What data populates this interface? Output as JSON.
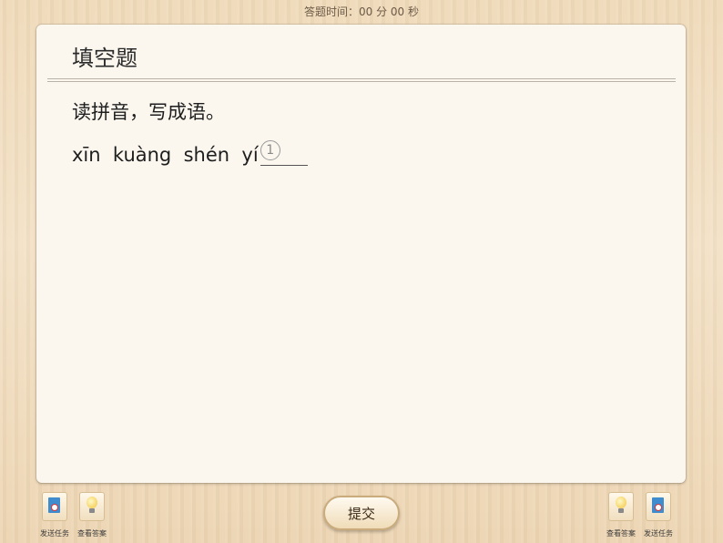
{
  "header": {
    "timer": "答题时间：00 分 00 秒"
  },
  "card": {
    "title": "填空题",
    "question": "读拼音，写成语。",
    "pinyin": "xīn  kuàng  shén  yí",
    "blank_number": "1"
  },
  "left_tools": [
    {
      "label": "发送任务",
      "icon": "send-task-icon"
    },
    {
      "label": "查看答案",
      "icon": "lightbulb-icon"
    }
  ],
  "right_tools": [
    {
      "label": "查看答案",
      "icon": "lightbulb-icon"
    },
    {
      "label": "发送任务",
      "icon": "send-task-icon"
    }
  ],
  "submit_label": "提交",
  "colors": {
    "wood": "#efd9b8",
    "card": "#fbf7ef",
    "book": "#3f8ccf",
    "bulb": "#f2c33a"
  }
}
